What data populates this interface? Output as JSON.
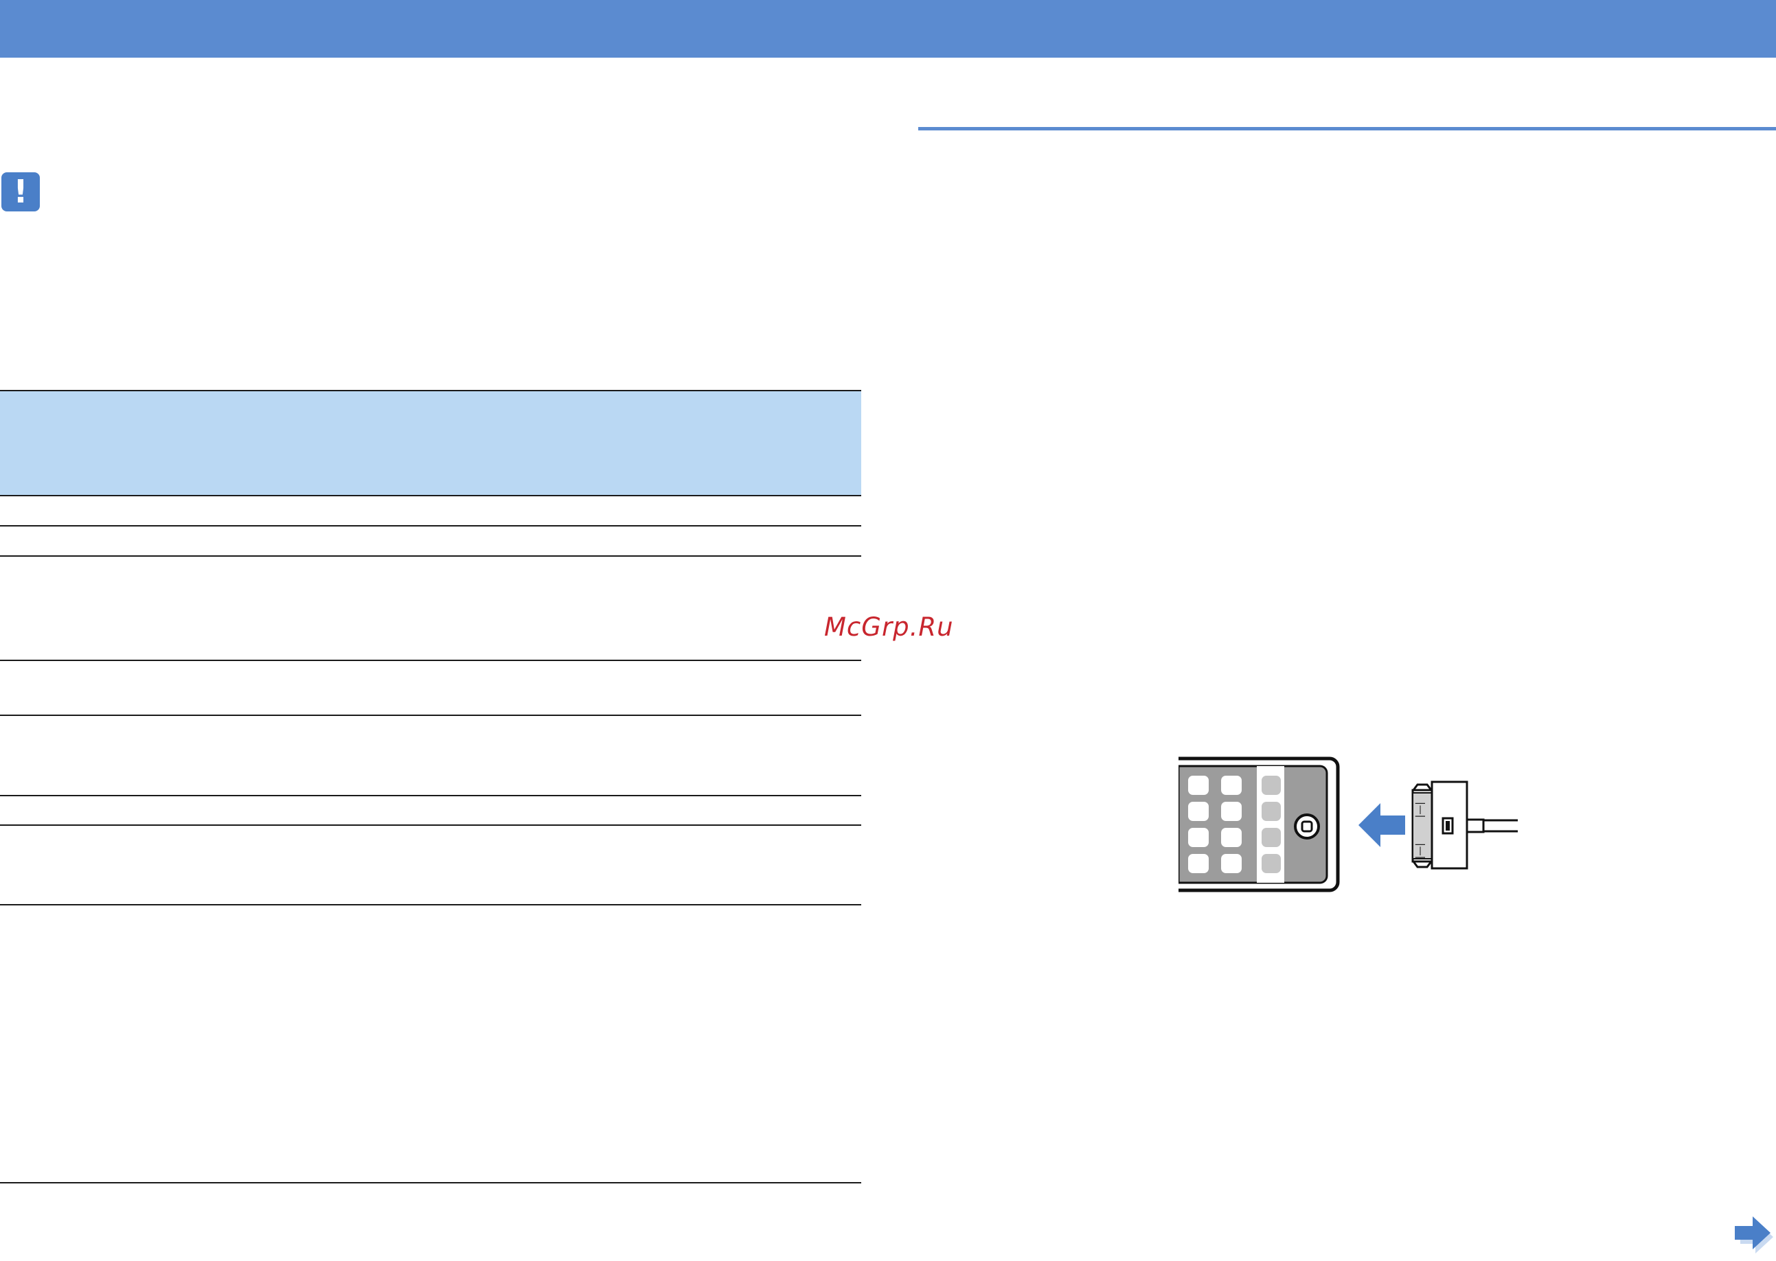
{
  "page": {
    "watermark": "McGrp.Ru"
  },
  "note": {
    "icon": "exclamation-icon",
    "glyph": "!"
  },
  "colors": {
    "header": "#5b8bd0",
    "table_head": "#bad8f3",
    "accent": "#4a7fc8",
    "watermark": "#c8262e"
  },
  "table": {
    "rows": 8
  },
  "figure": {
    "device": "ipod-device-icon",
    "arrow": "insert-arrow-icon",
    "connector": "dock-connector-icon"
  },
  "navigation": {
    "next": "next-page-arrow-icon"
  }
}
